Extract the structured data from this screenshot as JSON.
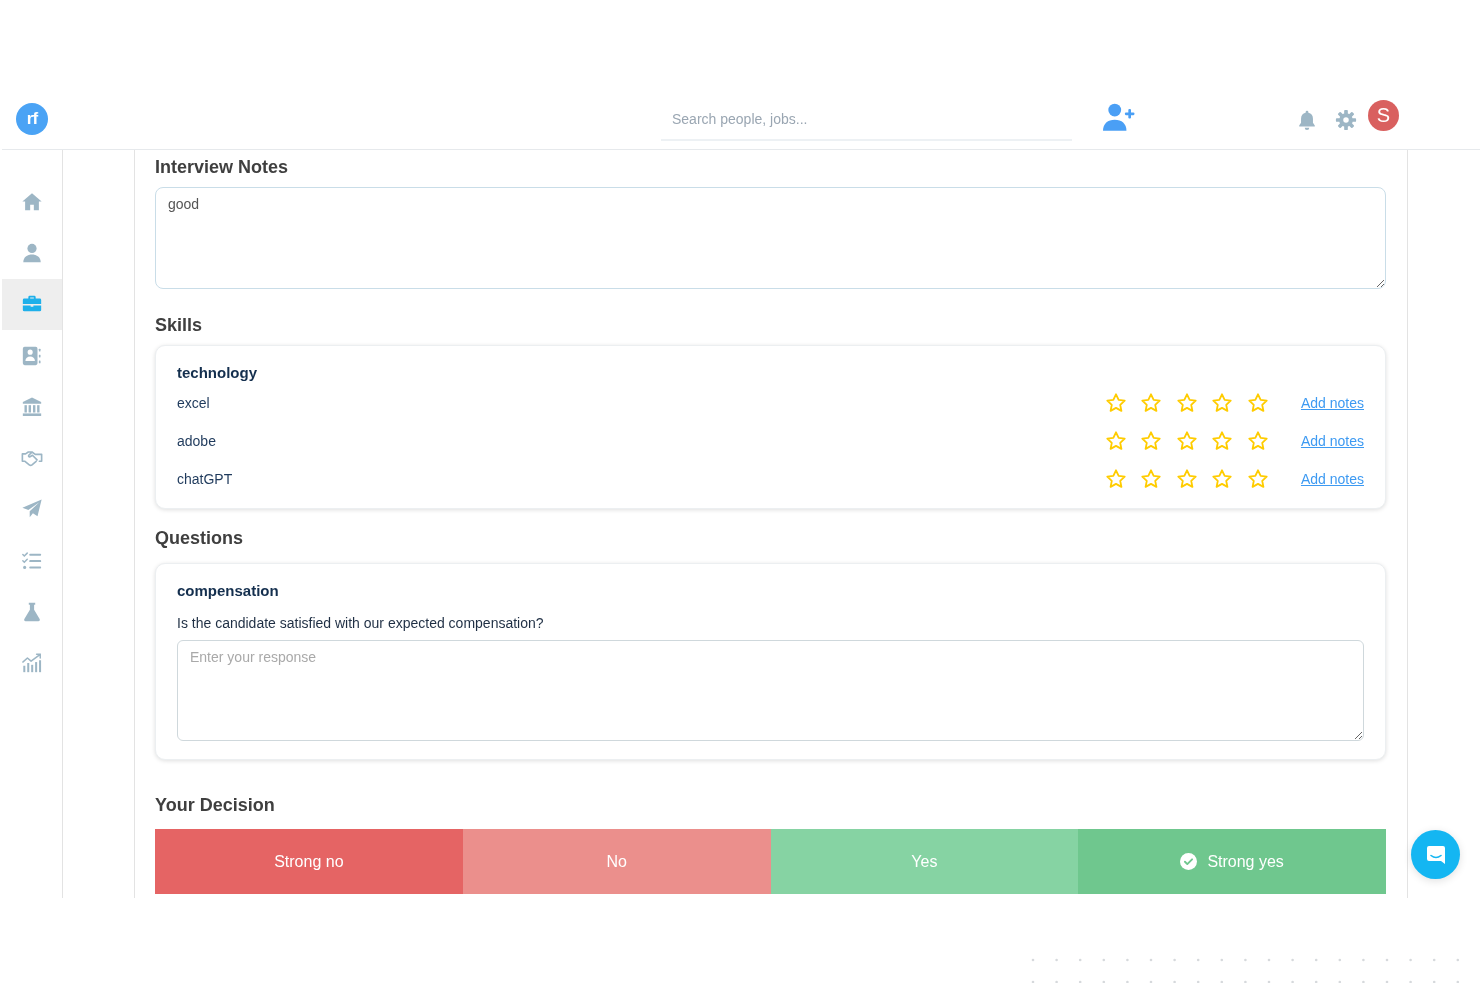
{
  "header": {
    "logo": "rf",
    "search": {
      "placeholder": "Search people, jobs..."
    },
    "avatar": "S"
  },
  "sidebar": {
    "items": [
      {
        "kind": "home",
        "selected": false
      },
      {
        "kind": "person",
        "selected": false
      },
      {
        "kind": "briefcase",
        "selected": true
      },
      {
        "kind": "contact-card",
        "selected": false
      },
      {
        "kind": "bank",
        "selected": false
      },
      {
        "kind": "handshake",
        "selected": false
      },
      {
        "kind": "paper-plane",
        "selected": false
      },
      {
        "kind": "checklist",
        "selected": false
      },
      {
        "kind": "flask",
        "selected": false
      },
      {
        "kind": "chart",
        "selected": false
      }
    ]
  },
  "interview_notes": {
    "title": "Interview Notes",
    "value": "good"
  },
  "skills": {
    "title": "Skills",
    "groups": [
      {
        "name": "technology",
        "items": [
          {
            "name": "excel",
            "stars": 0,
            "link": "Add notes"
          },
          {
            "name": "adobe",
            "stars": 0,
            "link": "Add notes"
          },
          {
            "name": "chatGPT",
            "stars": 0,
            "link": "Add notes"
          }
        ]
      }
    ]
  },
  "questions": {
    "title": "Questions",
    "items": [
      {
        "topic": "compensation",
        "question": "Is the candidate satisfied with our expected compensation?",
        "placeholder": "Enter your response"
      }
    ]
  },
  "decision": {
    "title": "Your Decision",
    "options": [
      {
        "label": "Strong no",
        "color": "#e56464",
        "selected": false
      },
      {
        "label": "No",
        "color": "#eb8f8c",
        "selected": false
      },
      {
        "label": "Yes",
        "color": "#86d3a3",
        "selected": false
      },
      {
        "label": "Strong yes",
        "color": "#6fc78e",
        "selected": true
      }
    ]
  }
}
